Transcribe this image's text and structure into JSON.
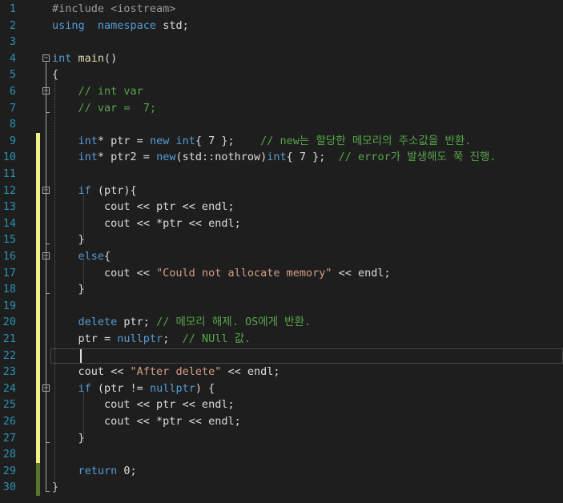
{
  "lines": [
    {
      "n": "1",
      "tokens": [
        [
          "pp",
          "#include <iostream>"
        ]
      ]
    },
    {
      "n": "2",
      "tokens": [
        [
          "kw",
          "using"
        ],
        [
          "",
          "  "
        ],
        [
          "kw",
          "namespace"
        ],
        [
          "",
          " std;"
        ]
      ]
    },
    {
      "n": "3",
      "tokens": []
    },
    {
      "n": "4",
      "tokens": [
        [
          "kw",
          "int"
        ],
        [
          "",
          " "
        ],
        [
          "fn",
          "main"
        ],
        [
          "",
          "()"
        ]
      ]
    },
    {
      "n": "5",
      "tokens": [
        [
          "",
          "{"
        ]
      ]
    },
    {
      "n": "6",
      "tokens": [
        [
          "",
          "    "
        ],
        [
          "cm",
          "// int var"
        ]
      ]
    },
    {
      "n": "7",
      "tokens": [
        [
          "",
          "    "
        ],
        [
          "cm",
          "// var =  7;"
        ]
      ]
    },
    {
      "n": "8",
      "tokens": []
    },
    {
      "n": "9",
      "tokens": [
        [
          "",
          "    "
        ],
        [
          "kw",
          "int"
        ],
        [
          "",
          "* ptr = "
        ],
        [
          "kw",
          "new"
        ],
        [
          "",
          " "
        ],
        [
          "kw",
          "int"
        ],
        [
          "",
          "{ 7 };    "
        ],
        [
          "cm",
          "// new는 할당한 메모리의 주소값을 반환."
        ]
      ]
    },
    {
      "n": "10",
      "tokens": [
        [
          "",
          "    "
        ],
        [
          "kw",
          "int"
        ],
        [
          "",
          "* ptr2 = "
        ],
        [
          "kw",
          "new"
        ],
        [
          "",
          "(std::nothrow)"
        ],
        [
          "kw",
          "int"
        ],
        [
          "",
          "{ 7 };  "
        ],
        [
          "cm",
          "// error가 발생해도 쭉 진행."
        ]
      ]
    },
    {
      "n": "11",
      "tokens": []
    },
    {
      "n": "12",
      "tokens": [
        [
          "",
          "    "
        ],
        [
          "kw",
          "if"
        ],
        [
          "",
          " (ptr){"
        ]
      ]
    },
    {
      "n": "13",
      "tokens": [
        [
          "",
          "        cout << ptr << endl;"
        ]
      ]
    },
    {
      "n": "14",
      "tokens": [
        [
          "",
          "        cout << *ptr << endl;"
        ]
      ]
    },
    {
      "n": "15",
      "tokens": [
        [
          "",
          "    }"
        ]
      ]
    },
    {
      "n": "16",
      "tokens": [
        [
          "",
          "    "
        ],
        [
          "kw",
          "else"
        ],
        [
          "",
          "{"
        ]
      ]
    },
    {
      "n": "17",
      "tokens": [
        [
          "",
          "        cout << "
        ],
        [
          "st",
          "\"Could not allocate memory\""
        ],
        [
          "",
          " << endl;"
        ]
      ]
    },
    {
      "n": "18",
      "tokens": [
        [
          "",
          "    }"
        ]
      ]
    },
    {
      "n": "19",
      "tokens": []
    },
    {
      "n": "20",
      "tokens": [
        [
          "",
          "    "
        ],
        [
          "kw",
          "delete"
        ],
        [
          "",
          " ptr; "
        ],
        [
          "cm",
          "// 메모리 해제. OS에게 반환."
        ]
      ]
    },
    {
      "n": "21",
      "tokens": [
        [
          "",
          "    ptr = "
        ],
        [
          "kw",
          "nullptr"
        ],
        [
          "",
          ";  "
        ],
        [
          "cm",
          "// NUll 값."
        ]
      ]
    },
    {
      "n": "22",
      "tokens": []
    },
    {
      "n": "23",
      "tokens": [
        [
          "",
          "    cout << "
        ],
        [
          "st",
          "\"After delete\""
        ],
        [
          "",
          " << endl;"
        ]
      ]
    },
    {
      "n": "24",
      "tokens": [
        [
          "",
          "    "
        ],
        [
          "kw",
          "if"
        ],
        [
          "",
          " (ptr != "
        ],
        [
          "kw",
          "nullptr"
        ],
        [
          "",
          ") {"
        ]
      ]
    },
    {
      "n": "25",
      "tokens": [
        [
          "",
          "        cout << ptr << endl;"
        ]
      ]
    },
    {
      "n": "26",
      "tokens": [
        [
          "",
          "        cout << *ptr << endl;"
        ]
      ]
    },
    {
      "n": "27",
      "tokens": [
        [
          "",
          "    }"
        ]
      ]
    },
    {
      "n": "28",
      "tokens": []
    },
    {
      "n": "29",
      "tokens": [
        [
          "",
          "    "
        ],
        [
          "kw",
          "return"
        ],
        [
          "",
          " 0;"
        ]
      ]
    },
    {
      "n": "30",
      "tokens": [
        [
          "",
          "}"
        ]
      ]
    }
  ],
  "fold_markers": {
    "4": "−",
    "6": "−",
    "12": "−",
    "16": "−",
    "24": "−"
  },
  "modified_yellow": [
    "9",
    "10",
    "11",
    "12",
    "13",
    "14",
    "15",
    "16",
    "17",
    "18",
    "19",
    "20",
    "21",
    "22",
    "23",
    "24",
    "25",
    "26",
    "27",
    "28"
  ],
  "modified_green": [
    "29",
    "30"
  ],
  "current_line": "22",
  "colors": {
    "background": "#1e1e1e",
    "line_number": "#2b91af",
    "keyword": "#569cd6",
    "comment": "#57a64a",
    "string": "#d69d85",
    "preprocessor": "#9b9b9b",
    "function": "#dcdcaa",
    "text": "#dcdcdc",
    "change_saved": "#577430",
    "change_unsaved": "#efef8b"
  }
}
